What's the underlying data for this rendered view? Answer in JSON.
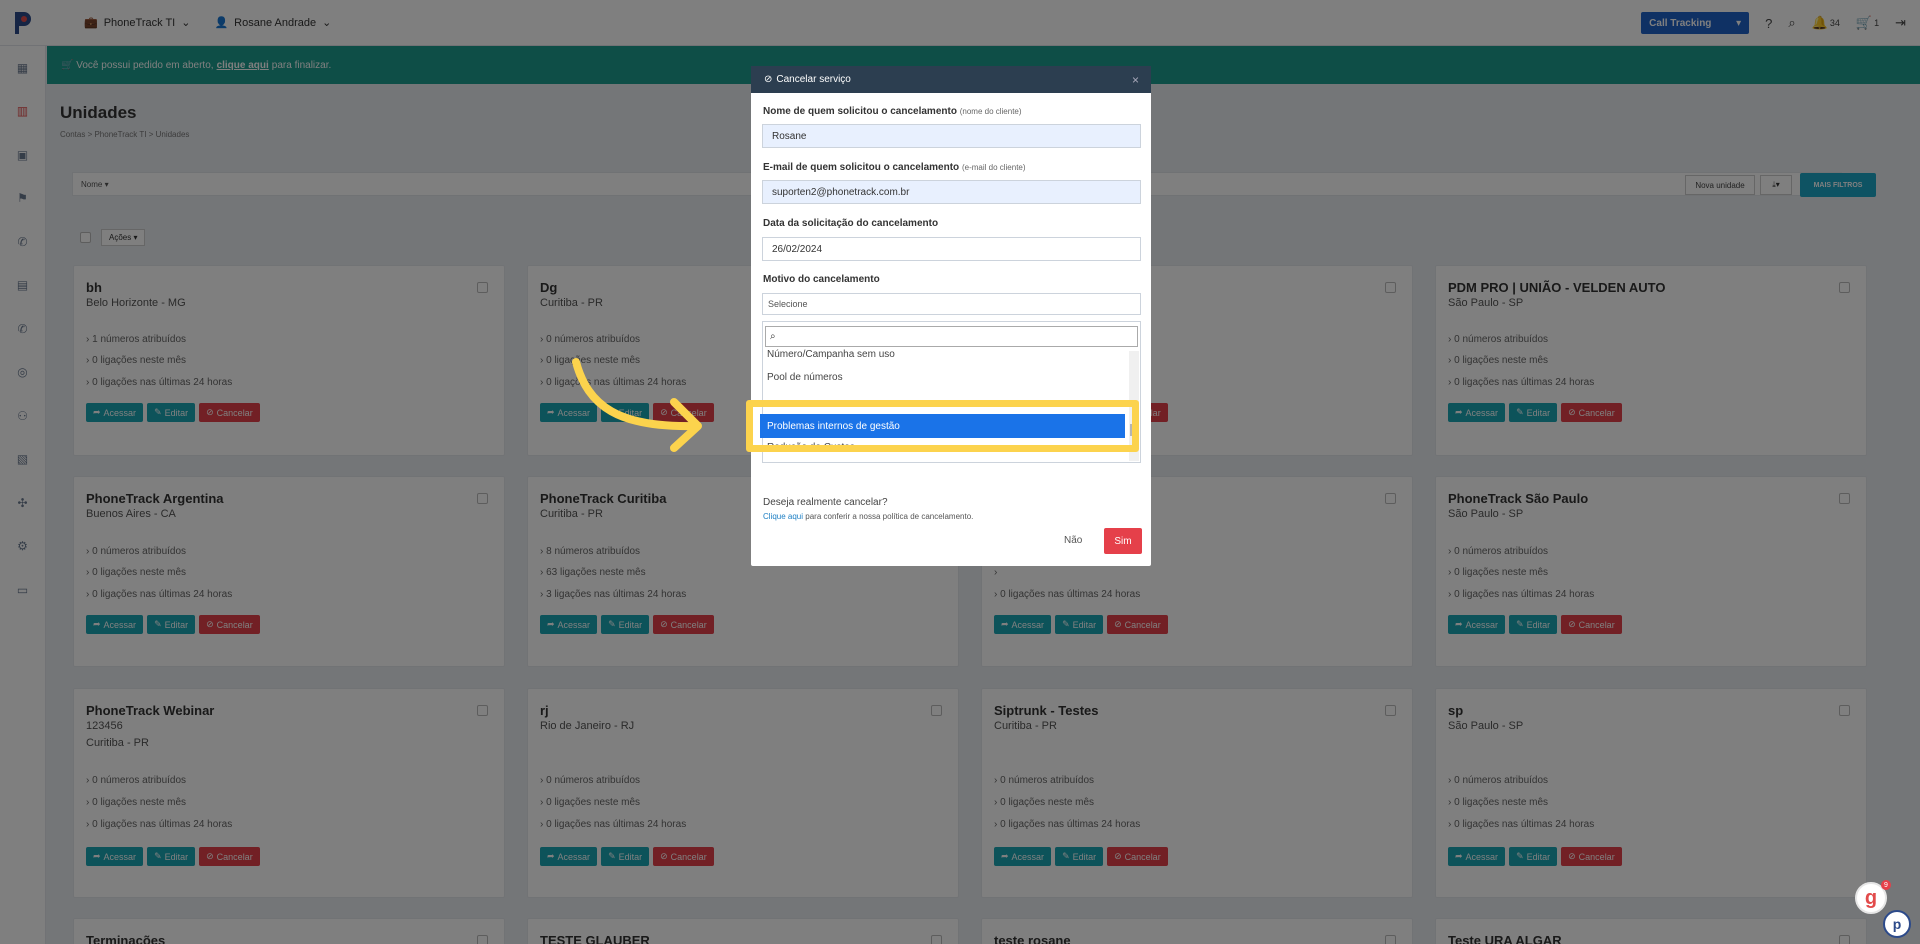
{
  "topbar": {
    "company": "PhoneTrack TI",
    "user": "Rosane Andrade",
    "product": "Call Tracking",
    "notifications": "34",
    "cart": "1"
  },
  "banner": {
    "prefix": "Você possui pedido em aberto,",
    "link": "clique aqui",
    "suffix": "para finalizar."
  },
  "page": {
    "title": "Unidades",
    "breadcrumb": "Contas  >  PhoneTrack TI  >  Unidades"
  },
  "toolbar": {
    "filter_label": "Nome",
    "nova_unidade": "Nova unidade",
    "mais_filtros": "MAIS FILTROS",
    "acoes": "Ações"
  },
  "card_buttons": {
    "acessar": "Acessar",
    "editar": "Editar",
    "cancelar": "Cancelar"
  },
  "cards": [
    {
      "name": "bh",
      "city": "Belo Horizonte - MG",
      "line1": "1 números atribuídos",
      "line2": "0 ligações neste mês",
      "line3": "0 ligações nas últimas 24 horas"
    },
    {
      "name": "Dg",
      "city": "Curitiba - PR",
      "line1": "0 números atribuídos",
      "line2": "0 ligações neste mês",
      "line3": "0 ligações nas últimas 24 horas"
    },
    {
      "name": "",
      "city": "",
      "line1": "",
      "line2": "",
      "line3": ""
    },
    {
      "name": "PDM PRO | UNIÃO - VELDEN AUTO",
      "city": "São Paulo - SP",
      "line1": "0 números atribuídos",
      "line2": "0 ligações neste mês",
      "line3": "0 ligações nas últimas 24 horas"
    },
    {
      "name": "PhoneTrack Argentina",
      "city": "Buenos Aires - CA",
      "line1": "0 números atribuídos",
      "line2": "0 ligações neste mês",
      "line3": "0 ligações nas últimas 24 horas"
    },
    {
      "name": "PhoneTrack Curitiba",
      "city": "Curitiba - PR",
      "line1": "8 números atribuídos",
      "line2": "63 ligações neste mês",
      "line3": "3 ligações nas últimas 24 horas"
    },
    {
      "name": "",
      "city": "",
      "line1": "",
      "line2": "",
      "line3": "0 ligações nas últimas 24 horas"
    },
    {
      "name": "PhoneTrack São Paulo",
      "city": "São Paulo - SP",
      "line1": "0 números atribuídos",
      "line2": "0 ligações neste mês",
      "line3": "0 ligações nas últimas 24 horas"
    },
    {
      "name": "PhoneTrack Webinar",
      "city": "123456",
      "city2": "Curitiba - PR",
      "line1": "0 números atribuídos",
      "line2": "0 ligações neste mês",
      "line3": "0 ligações nas últimas 24 horas"
    },
    {
      "name": "rj",
      "city": "Rio de Janeiro - RJ",
      "line1": "0 números atribuídos",
      "line2": "0 ligações neste mês",
      "line3": "0 ligações nas últimas 24 horas"
    },
    {
      "name": "Siptrunk - Testes",
      "city": "Curitiba - PR",
      "line1": "0 números atribuídos",
      "line2": "0 ligações neste mês",
      "line3": "0 ligações nas últimas 24 horas"
    },
    {
      "name": "sp",
      "city": "São Paulo - SP",
      "line1": "0 números atribuídos",
      "line2": "0 ligações neste mês",
      "line3": "0 ligações nas últimas 24 horas"
    },
    {
      "name": "Terminações"
    },
    {
      "name": "TESTE GLAUBER"
    },
    {
      "name": "teste rosane"
    },
    {
      "name": "Teste URA ALGAR"
    }
  ],
  "modal": {
    "title": "Cancelar serviço",
    "name_label": "Nome de quem solicitou o cancelamento",
    "name_hint": "(nome do cliente)",
    "name_value": "Rosane",
    "email_label": "E-mail de quem solicitou o cancelamento",
    "email_hint": "(e-mail do cliente)",
    "email_value": "suporten2@phonetrack.com.br",
    "date_label": "Data da solicitação do cancelamento",
    "date_value": "26/02/2024",
    "reason_label": "Motivo do cancelamento",
    "reason_placeholder": "Selecione",
    "options": [
      "Número/Campanha sem uso",
      "Pool de números",
      "Problemas internos de gestão",
      "Redução de Custos"
    ],
    "highlighted_option": "Problemas internos de gestão",
    "confirm_question": "Deseja realmente cancelar?",
    "confirm_link": "Clique aqui",
    "confirm_link_suffix": "para conferir a nossa política de cancelamento.",
    "no": "Não",
    "yes": "Sim"
  },
  "colors": {
    "brand": "#1f63c9",
    "banner": "#1d9c8e",
    "danger": "#e5404a",
    "highlight": "#fcd34d",
    "option_selected": "#1a73e8"
  }
}
